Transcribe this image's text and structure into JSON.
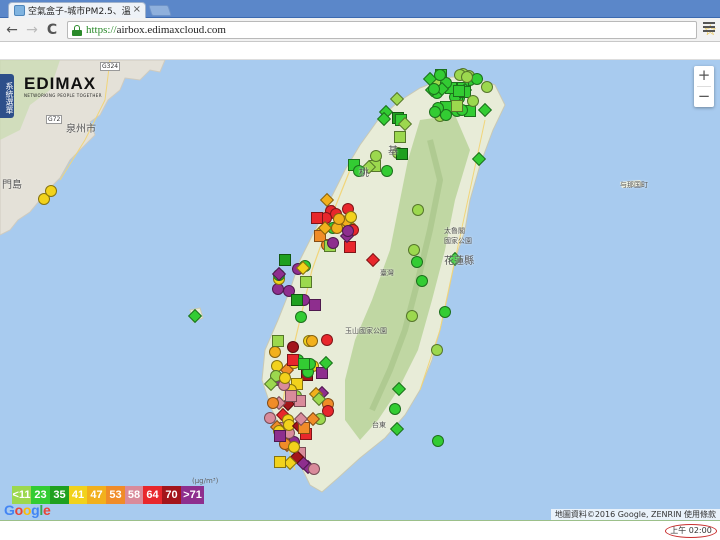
{
  "browser": {
    "tab_title": "空氣盒子-城市PM2.5、溫",
    "tab_close": "×",
    "back_glyph": "←",
    "forward_glyph": "→",
    "reload_glyph": "C",
    "url_scheme": "https://",
    "url_host": "airbox.edimaxcloud.com",
    "star_glyph": "☆"
  },
  "map": {
    "panel_toggle": "系統選單",
    "logo": {
      "brand": "EDIMAX",
      "tagline": "NETWORKING PEOPLE TOGETHER"
    },
    "zoom_in": "+",
    "zoom_out": "−",
    "labels": {
      "quanzhou": "泉州市",
      "mendao": "門島",
      "taibei": "基",
      "taoyuan": "桃",
      "taiwan": "臺灣",
      "yushan": "玉山國家公園",
      "taroko": "太魯閣\n國家公園",
      "hualien": "花蓮縣",
      "taidong": "台東",
      "yonaguni": "与那国町",
      "road_g324": "G324",
      "road_g72": "G72"
    },
    "legend": [
      {
        "label": "<11",
        "color": "#9cd84e"
      },
      {
        "label": "23",
        "color": "#33cc33"
      },
      {
        "label": "35",
        "color": "#1fa01f"
      },
      {
        "label": "41",
        "color": "#f2d21c"
      },
      {
        "label": "47",
        "color": "#f2b01c"
      },
      {
        "label": "53",
        "color": "#f08c28"
      },
      {
        "label": "58",
        "color": "#d98b9b"
      },
      {
        "label": "64",
        "color": "#e8272c"
      },
      {
        "label": "70",
        "color": "#a3151b"
      },
      {
        "label": ">71",
        "color": "#8e2e8e"
      }
    ],
    "legend_unit": "(μg/m³)",
    "google_logo": "Google",
    "attribution": "地圖資料©2016 Google, ZENRIN   使用條款"
  },
  "status": {
    "clock": "上午 02:00"
  }
}
